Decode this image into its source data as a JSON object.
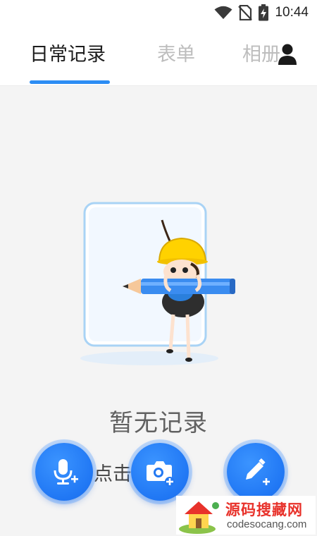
{
  "status_bar": {
    "time": "10:44",
    "icons": [
      "wifi-icon",
      "no-sim-icon",
      "battery-charging-icon"
    ]
  },
  "tabs": [
    {
      "label": "日常记录",
      "active": true
    },
    {
      "label": "表单",
      "active": false
    },
    {
      "label": "相册",
      "active": false
    }
  ],
  "header": {
    "profile_icon": "person-icon"
  },
  "accent_color": "#2c8df4",
  "empty_state": {
    "title": "暂无记录",
    "hint": "点击  钮创",
    "illustration": "ant-with-pencil"
  },
  "actions": [
    {
      "icon": "microphone-add-icon"
    },
    {
      "icon": "camera-add-icon"
    },
    {
      "icon": "pencil-add-icon"
    }
  ],
  "watermark": {
    "title": "源码搜藏网",
    "url": "codesocang.com"
  }
}
